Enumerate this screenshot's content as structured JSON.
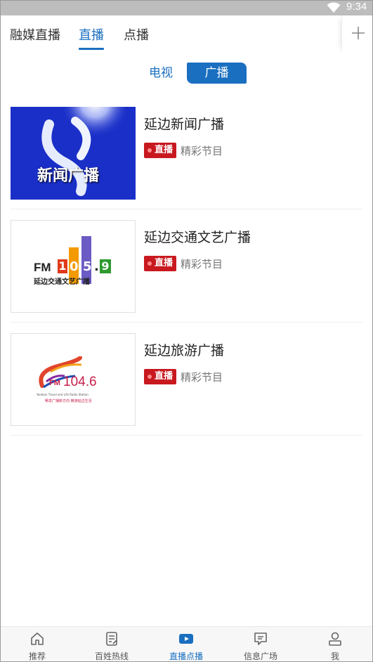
{
  "status_bar": {
    "time": "9:34"
  },
  "top_tabs": [
    {
      "label": "融媒直播",
      "active": false
    },
    {
      "label": "直播",
      "active": true
    },
    {
      "label": "点播",
      "active": false
    }
  ],
  "segmented": {
    "tv": "电视",
    "radio": "广播",
    "selected": "radio"
  },
  "items": [
    {
      "title": "延边新闻广播",
      "badge": "直播",
      "subtitle": "精彩节目",
      "thumb_text": "新闻广播"
    },
    {
      "title": "延边交通文艺广播",
      "badge": "直播",
      "subtitle": "精彩节目",
      "thumb_fm": "FM",
      "thumb_digits": [
        "1",
        "0",
        "5",
        ".",
        "9"
      ],
      "thumb_caption": "延边交通文艺广播"
    },
    {
      "title": "延边旅游广播",
      "badge": "直播",
      "subtitle": "精彩节目",
      "thumb_fm": "FM",
      "thumb_freq": "104.6",
      "thumb_line1": "Yanbian Travel and Life Radio Station",
      "thumb_line2": "畅享广播新方向    精游延边生活"
    }
  ],
  "bottom_nav": [
    {
      "label": "推荐",
      "icon": "home-icon",
      "active": false
    },
    {
      "label": "百姓热线",
      "icon": "hotline-icon",
      "active": false
    },
    {
      "label": "直播点播",
      "icon": "play-icon",
      "active": true
    },
    {
      "label": "信息广场",
      "icon": "message-icon",
      "active": false
    },
    {
      "label": "我",
      "icon": "user-icon",
      "active": false
    }
  ],
  "colors": {
    "accent": "#1a6fc0",
    "live_red": "#c8191f",
    "status_bar": "#bdbdbd"
  }
}
